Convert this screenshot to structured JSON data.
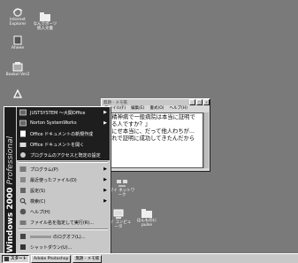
{
  "desktop": {
    "icons": [
      {
        "label": "Internet Explorer",
        "icon": "ie-icon"
      },
      {
        "label": "なんでポーツ\n統入文書",
        "icon": "folder-icon"
      },
      {
        "label": "Aheee",
        "icon": "app-icon"
      },
      {
        "label": "Bookxl Ver2",
        "icon": "book-app-icon"
      },
      {
        "label": "",
        "icon": "recycle-bin-icon"
      },
      {
        "label": "マイ ネットワーク",
        "icon": "network-icon"
      },
      {
        "label": "マイ コンピュータ",
        "icon": "computer-icon"
      },
      {
        "label": "ほんものに\npulse",
        "icon": "folder-icon"
      }
    ]
  },
  "start_menu": {
    "banner": {
      "brand": "Windows 2000",
      "edition": "Professional"
    },
    "top_items": [
      {
        "label": "JUSTSYSTEM ～大関Office",
        "icon": "program-group-icon",
        "has_submenu": true
      },
      {
        "label": "Norton SystemWorks",
        "icon": "program-group-icon",
        "has_submenu": true
      },
      {
        "label": "Office ドキュメントの新規作成",
        "icon": "office-new-icon",
        "has_submenu": false
      },
      {
        "label": "Office ドキュメントを開く",
        "icon": "office-open-icon",
        "has_submenu": false
      },
      {
        "label": "プログラムのアクセスと既定の設定",
        "icon": "defaults-icon",
        "has_submenu": false
      }
    ],
    "main_items": [
      {
        "label": "プログラム(P)",
        "icon": "programs-icon",
        "has_submenu": true
      },
      {
        "label": "最近使ったファイル(D)",
        "icon": "documents-icon",
        "has_submenu": true
      },
      {
        "label": "設定(S)",
        "icon": "settings-icon",
        "has_submenu": true
      },
      {
        "label": "検索(C)",
        "icon": "search-icon",
        "has_submenu": true
      },
      {
        "label": "ヘルプ(H)",
        "icon": "help-icon",
        "has_submenu": false
      },
      {
        "label": "ファイル名を指定して実行(R)...",
        "icon": "run-icon",
        "has_submenu": false
      }
    ],
    "bottom_items": [
      {
        "label": "のログオフ(L)...",
        "icon": "logoff-icon"
      },
      {
        "label": "シャットダウン(U)...",
        "icon": "shutdown-icon"
      }
    ],
    "colors": {
      "banner": "#1b1b1b",
      "highlight": "#1e1e1e"
    }
  },
  "notepad": {
    "title": "無題 - メモ帳",
    "menus": [
      "ファイル(F)",
      "編集(E)",
      "書式(O)",
      "ヘルプ(H)"
    ],
    "content": "『精神病で一般病院は本当に証明できる人ですか？』\nなにせ本当に、だって他人わちが...\nなれで証明に成功してきたんだから"
  },
  "taskbar": {
    "start_label": "スタート",
    "buttons": [
      "Adobe Photoshop",
      "無題 - メモ帳"
    ]
  }
}
